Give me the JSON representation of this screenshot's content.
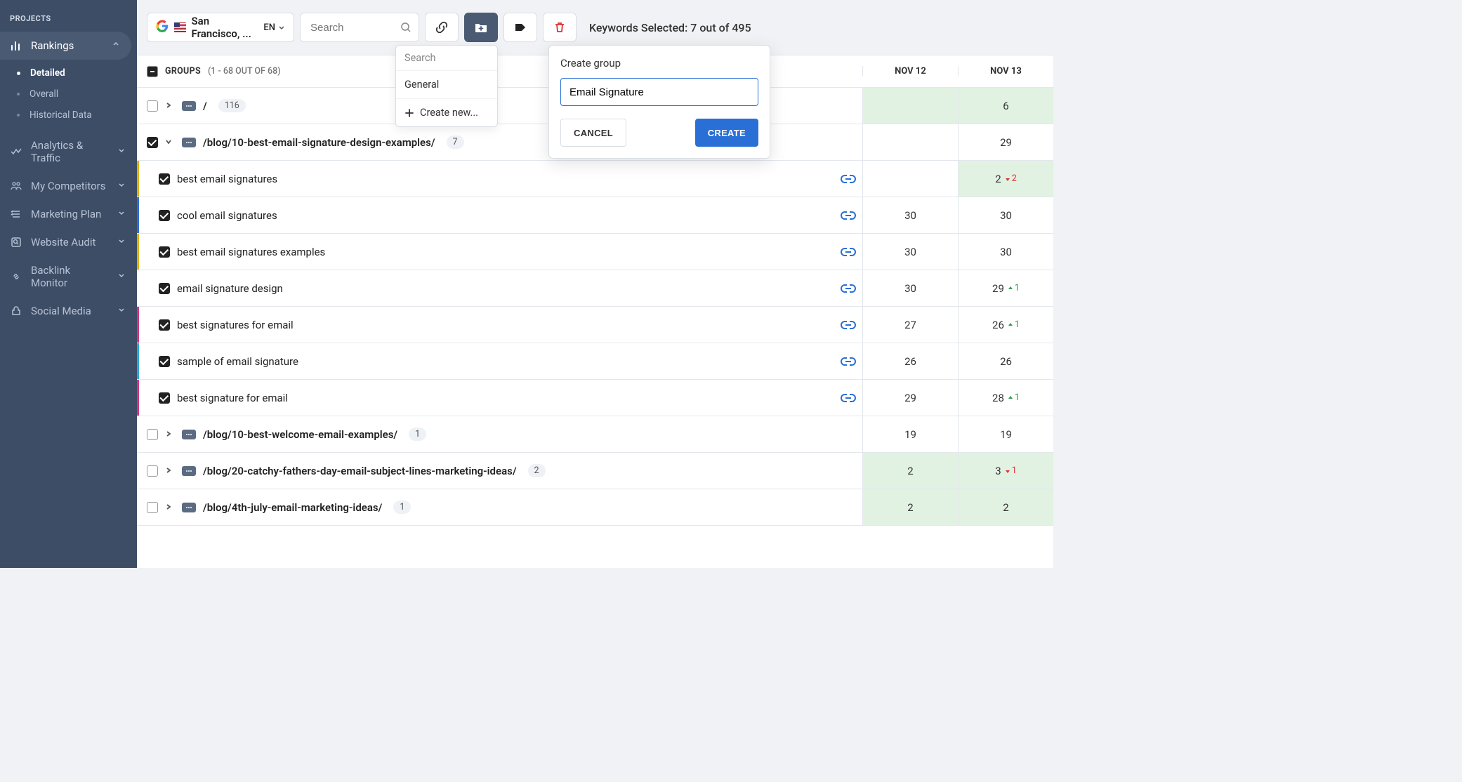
{
  "sidebar": {
    "header": "PROJECTS",
    "items": [
      {
        "label": "Rankings",
        "sub": [
          {
            "label": "Detailed"
          },
          {
            "label": "Overall"
          },
          {
            "label": "Historical Data"
          }
        ]
      },
      {
        "label": "Analytics & Traffic"
      },
      {
        "label": "My Competitors"
      },
      {
        "label": "Marketing Plan"
      },
      {
        "label": "Website Audit"
      },
      {
        "label": "Backlink Monitor"
      },
      {
        "label": "Social Media"
      }
    ]
  },
  "toolbar": {
    "location": "San Francisco, ...",
    "lang": "EN",
    "search_ph": "Search",
    "selected": "Keywords Selected: 7 out of 495"
  },
  "folder_dd": {
    "search": "Search",
    "items": [
      "General"
    ],
    "create": "Create new..."
  },
  "popover": {
    "title": "Create group",
    "value": "Email Signature",
    "cancel": "CANCEL",
    "create": "CREATE"
  },
  "table": {
    "groups_label": "GROUPS",
    "groups_count": "(1 - 68 OUT OF 68)",
    "dates": [
      "NOV 12",
      "NOV 13"
    ],
    "rows": [
      {
        "type": "group",
        "chk": false,
        "caret": "right",
        "path": "/",
        "badge": "116",
        "cells": [
          {
            "v": "",
            "hl": true
          },
          {
            "v": "6",
            "hl": true
          }
        ]
      },
      {
        "type": "group",
        "chk": true,
        "caret": "down",
        "path": "/blog/10-best-email-signature-design-examples/",
        "badge": "7",
        "cells": [
          {
            "v": ""
          },
          {
            "v": "29"
          }
        ]
      },
      {
        "type": "kw",
        "chk": true,
        "bar": "#e2b100",
        "text": "best email signatures",
        "link": true,
        "cells": [
          {
            "v": ""
          },
          {
            "v": "2",
            "hl": true,
            "delta": {
              "dir": "dn",
              "v": "2"
            }
          }
        ]
      },
      {
        "type": "kw",
        "chk": true,
        "bar": "#2a6fd6",
        "text": "cool email signatures",
        "link": true,
        "cells": [
          {
            "v": "30"
          },
          {
            "v": "30"
          }
        ]
      },
      {
        "type": "kw",
        "chk": true,
        "bar": "#e2b100",
        "text": "best email signatures examples",
        "link": true,
        "cells": [
          {
            "v": "30"
          },
          {
            "v": "30"
          }
        ]
      },
      {
        "type": "kw",
        "chk": true,
        "bar": "",
        "text": "email signature design",
        "link": true,
        "cells": [
          {
            "v": "30"
          },
          {
            "v": "29",
            "delta": {
              "dir": "up",
              "v": "1"
            }
          }
        ]
      },
      {
        "type": "kw",
        "chk": true,
        "bar": "#d63384",
        "text": "best signatures for email",
        "link": true,
        "cells": [
          {
            "v": "27"
          },
          {
            "v": "26",
            "delta": {
              "dir": "up",
              "v": "1"
            }
          }
        ]
      },
      {
        "type": "kw",
        "chk": true,
        "bar": "#2aa7d6",
        "text": "sample of email signature",
        "link": true,
        "cells": [
          {
            "v": "26"
          },
          {
            "v": "26"
          }
        ]
      },
      {
        "type": "kw",
        "chk": true,
        "bar": "#d63384",
        "text": "best signature for email",
        "link": true,
        "cells": [
          {
            "v": "29"
          },
          {
            "v": "28",
            "delta": {
              "dir": "up",
              "v": "1"
            }
          }
        ]
      },
      {
        "type": "group",
        "chk": false,
        "caret": "right",
        "path": "/blog/10-best-welcome-email-examples/",
        "badge": "1",
        "cells": [
          {
            "v": "19"
          },
          {
            "v": "19"
          }
        ]
      },
      {
        "type": "group",
        "chk": false,
        "caret": "right",
        "path": "/blog/20-catchy-fathers-day-email-subject-lines-marketing-ideas/",
        "badge": "2",
        "cells": [
          {
            "v": "2",
            "hl": true
          },
          {
            "v": "3",
            "hl": true,
            "delta": {
              "dir": "dn",
              "v": "1"
            }
          }
        ]
      },
      {
        "type": "group",
        "chk": false,
        "caret": "right",
        "path": "/blog/4th-july-email-marketing-ideas/",
        "badge": "1",
        "cells": [
          {
            "v": "2",
            "hl": true
          },
          {
            "v": "2",
            "hl": true
          }
        ]
      }
    ]
  }
}
